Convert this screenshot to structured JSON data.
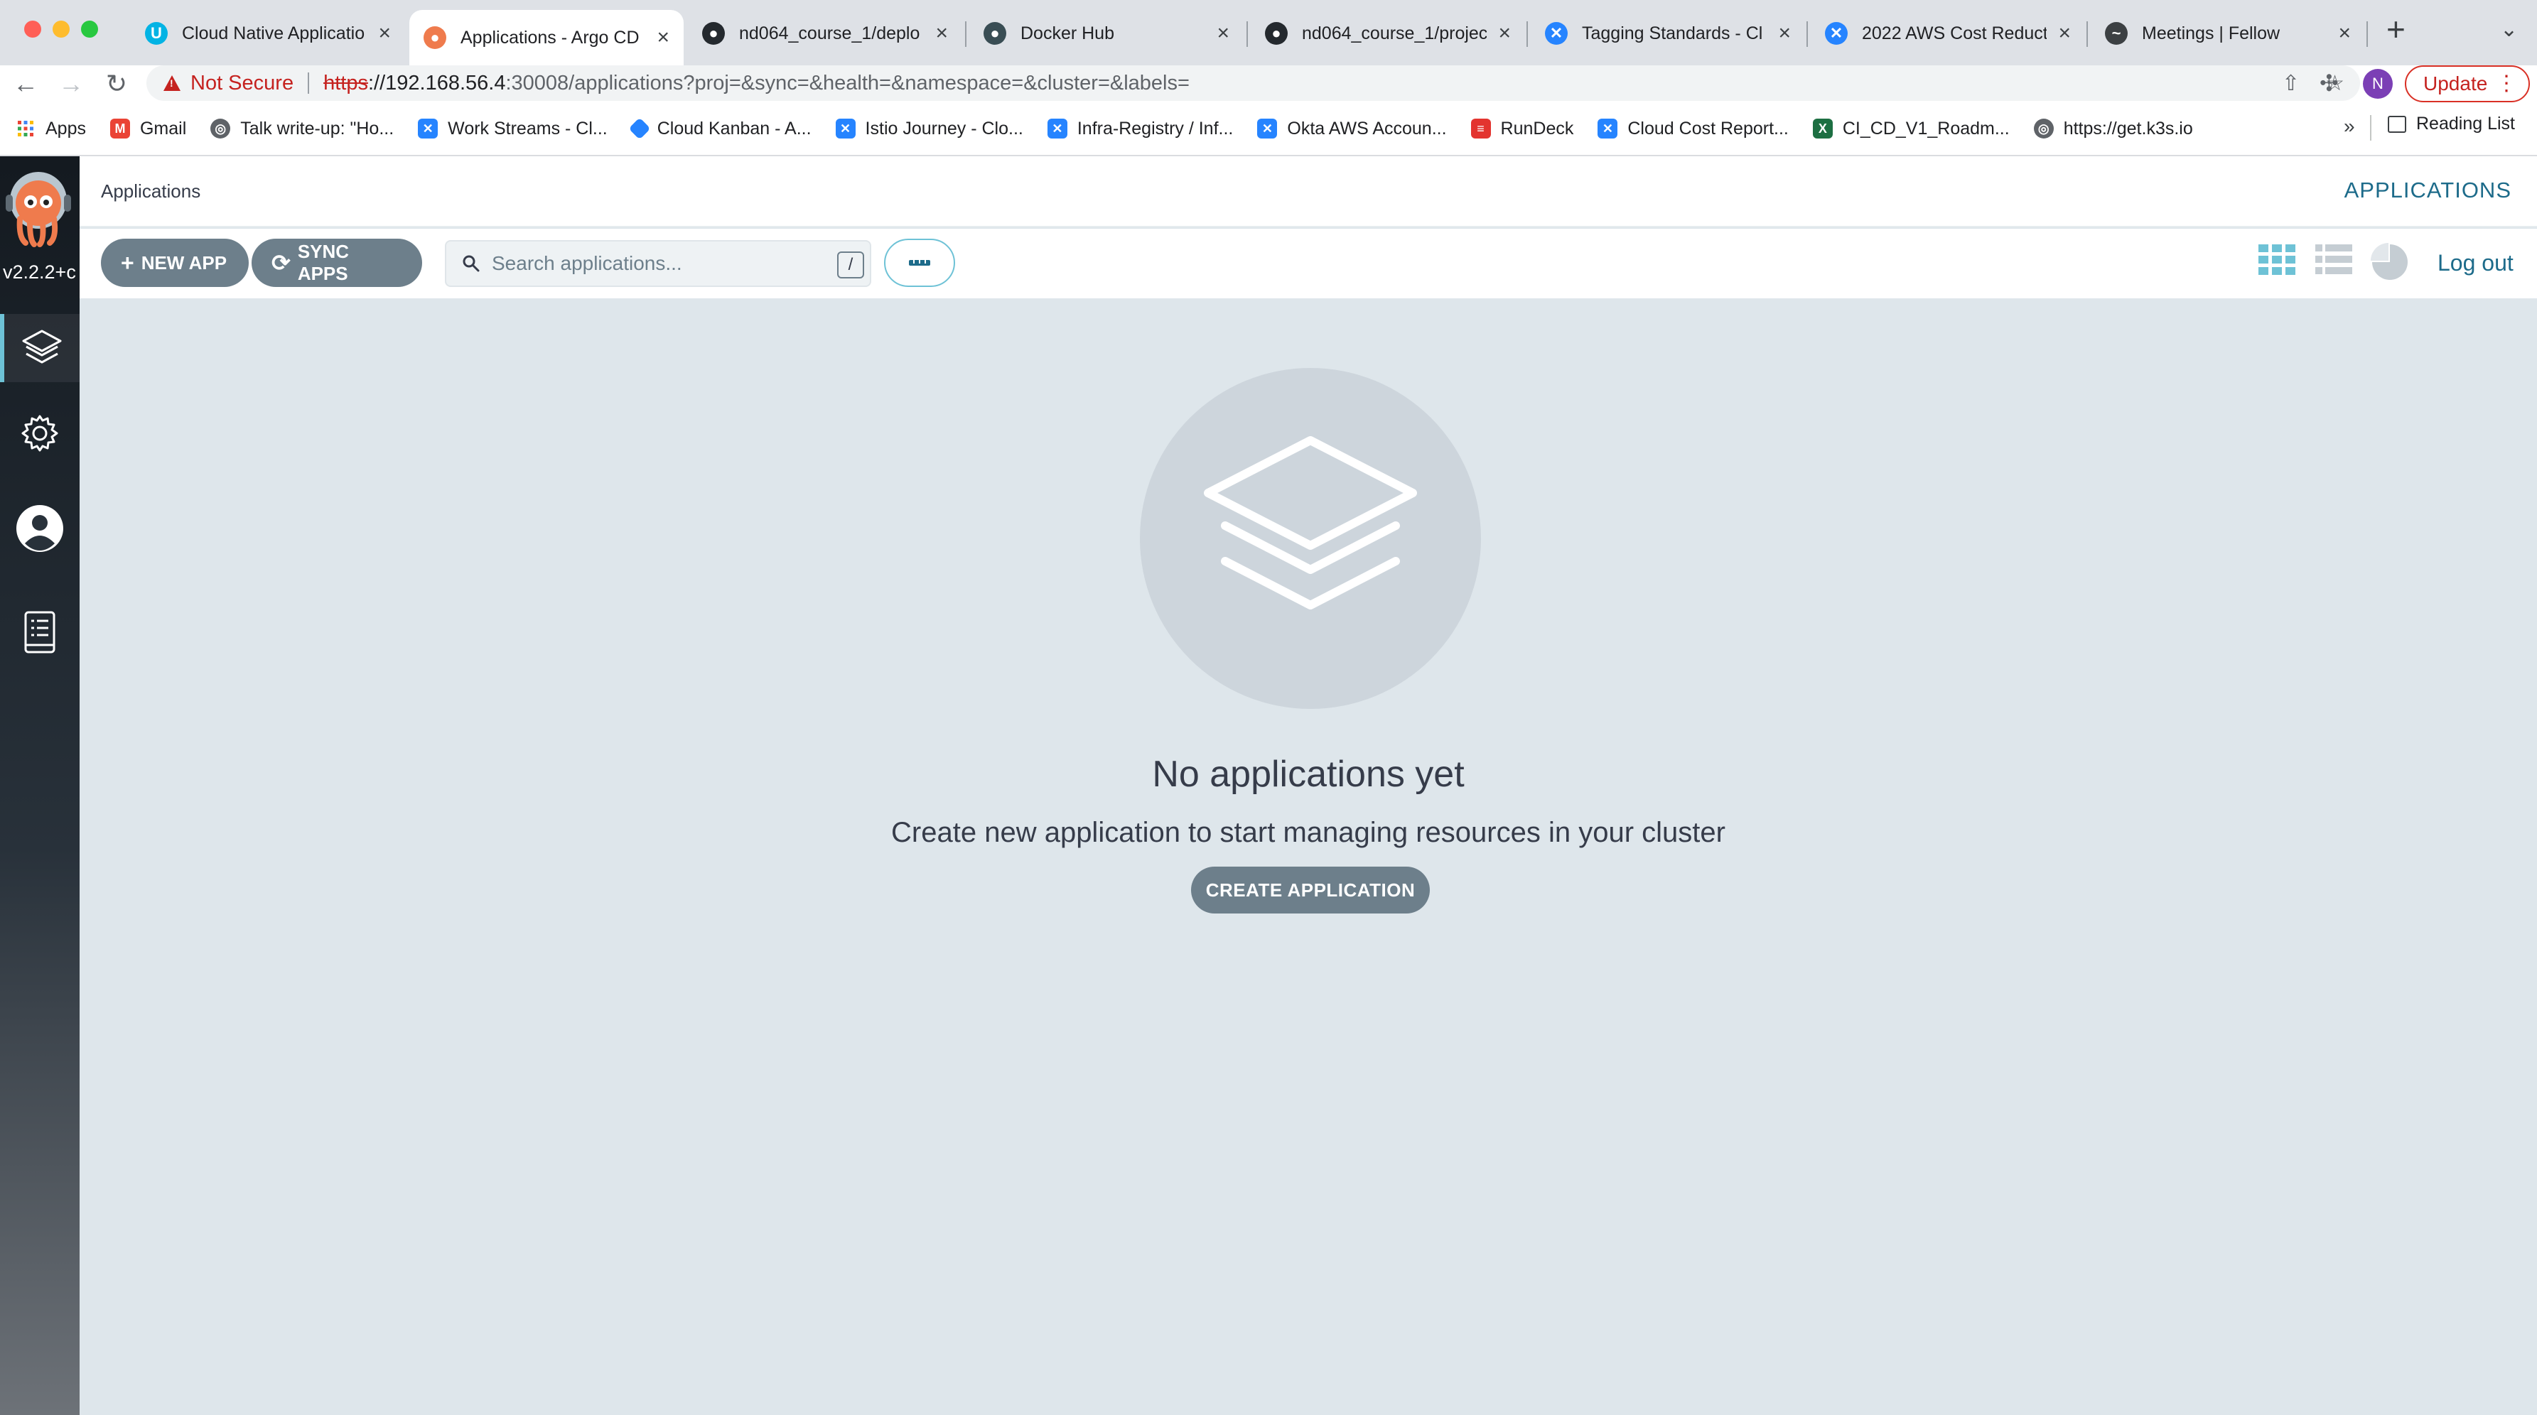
{
  "browser": {
    "tabs": [
      {
        "title": "Cloud Native Applicatio",
        "favicon": "udacity-icon",
        "color": "#02b3e4"
      },
      {
        "title": "Applications - Argo CD",
        "favicon": "argo-icon",
        "color": "#ef7b4d"
      },
      {
        "title": "nd064_course_1/deplo",
        "favicon": "github-icon",
        "color": "#24292e"
      },
      {
        "title": "Docker Hub",
        "favicon": "docker-icon",
        "color": "#394d54"
      },
      {
        "title": "nd064_course_1/projec",
        "favicon": "github-icon",
        "color": "#24292e"
      },
      {
        "title": "Tagging Standards - Cl",
        "favicon": "confluence-icon",
        "color": "#2684ff"
      },
      {
        "title": "2022 AWS Cost Reduct",
        "favicon": "confluence-icon",
        "color": "#2684ff"
      },
      {
        "title": "Meetings | Fellow",
        "favicon": "fellow-icon",
        "color": "#3c4043"
      }
    ],
    "active_tab_index": 1,
    "omnibox": {
      "security_label": "Not Secure",
      "url_scheme": "https",
      "url_host": "://192.168.56.4",
      "url_rest": ":30008/applications?proj=&sync=&health=&namespace=&cluster=&labels="
    },
    "profile_initial": "N",
    "update_label": "Update",
    "bookmarks": [
      {
        "label": "Apps",
        "icon": "apps-grid-icon",
        "color": "#4285f4"
      },
      {
        "label": "Gmail",
        "icon": "gmail-icon",
        "color": "#ea4335"
      },
      {
        "label": "Talk write-up: \"Ho...",
        "icon": "globe-icon",
        "color": "#5f6368"
      },
      {
        "label": "Work Streams - Cl...",
        "icon": "confluence-icon",
        "color": "#2684ff"
      },
      {
        "label": "Cloud Kanban - A...",
        "icon": "jira-icon",
        "color": "#2684ff"
      },
      {
        "label": "Istio Journey - Clo...",
        "icon": "confluence-icon",
        "color": "#2684ff"
      },
      {
        "label": "Infra-Registry / Inf...",
        "icon": "confluence-icon",
        "color": "#2684ff"
      },
      {
        "label": "Okta AWS Accoun...",
        "icon": "confluence-icon",
        "color": "#2684ff"
      },
      {
        "label": "RunDeck",
        "icon": "rundeck-icon",
        "color": "#e3342f"
      },
      {
        "label": "Cloud Cost Report...",
        "icon": "confluence-icon",
        "color": "#2684ff"
      },
      {
        "label": "CI_CD_V1_Roadm...",
        "icon": "excel-icon",
        "color": "#1d6f42"
      },
      {
        "label": "https://get.k3s.io",
        "icon": "globe-icon",
        "color": "#5f6368"
      }
    ],
    "bookmarks_overflow": "»",
    "reading_list_label": "Reading List"
  },
  "app": {
    "version": "v2.2.2+c",
    "breadcrumb": "Applications",
    "header_title": "APPLICATIONS",
    "new_app_label": "NEW APP",
    "sync_apps_label": "SYNC APPS",
    "search_placeholder": "Search applications...",
    "search_shortcut": "/",
    "logout_label": "Log out",
    "empty_title": "No applications yet",
    "empty_subtitle": "Create new application to start managing resources in your cluster",
    "create_app_label": "CREATE APPLICATION",
    "colors": {
      "accent": "#6ec2d6",
      "link": "#1d6b8a",
      "button": "#6d7f8b",
      "background": "#dee6eb"
    }
  }
}
